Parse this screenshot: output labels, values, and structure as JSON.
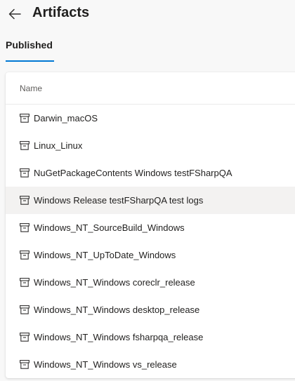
{
  "header": {
    "title": "Artifacts",
    "back_icon": "arrow-left-icon"
  },
  "tabs": [
    {
      "label": "Published",
      "selected": true
    }
  ],
  "accent_color": "#0078d4",
  "table": {
    "column_header": "Name",
    "row_icon": "package-icon",
    "rows": [
      "Darwin_macOS",
      "Linux_Linux",
      "NuGetPackageContents Windows testFSharpQA",
      "Windows Release testFSharpQA test logs",
      "Windows_NT_SourceBuild_Windows",
      "Windows_NT_UpToDate_Windows",
      "Windows_NT_Windows coreclr_release",
      "Windows_NT_Windows desktop_release",
      "Windows_NT_Windows fsharpqa_release",
      "Windows_NT_Windows vs_release"
    ],
    "hovered_row": "Windows Release testFSharpQA test logs"
  }
}
